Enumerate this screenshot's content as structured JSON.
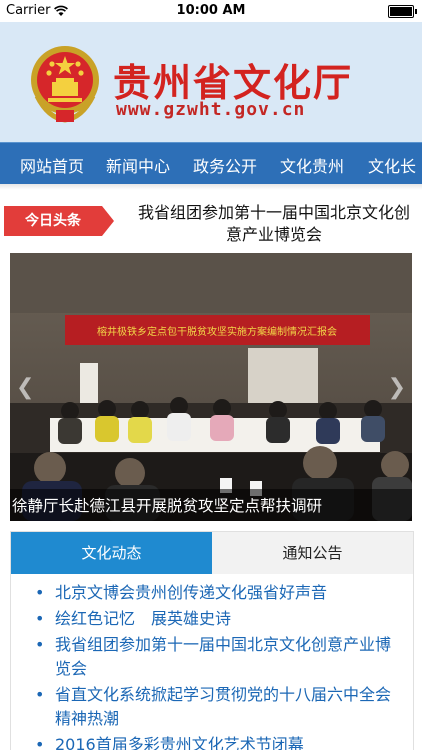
{
  "status_bar": {
    "carrier": "Carrier",
    "time": "10:00 AM"
  },
  "header": {
    "site_name": "贵州省文化厅",
    "site_url": "www.gzwht.gov.cn"
  },
  "nav": {
    "items": [
      "网站首页",
      "新闻中心",
      "政务公开",
      "文化贵州",
      "文化长"
    ]
  },
  "headline": {
    "badge": "今日头条",
    "text": "我省组团参加第十一届中国北京文化创意产业博览会"
  },
  "slider": {
    "banner_text": "榕井极铁乡定点包干脱贫攻坚实施方案编制情况汇报会",
    "caption": "徐静厅长赴德江县开展脱贫攻坚定点帮扶调研"
  },
  "tabs": {
    "active": "文化动态",
    "inactive": "通知公告"
  },
  "news": {
    "items": [
      "北京文博会贵州创传递文化强省好声音",
      "绘红色记忆　展英雄史诗",
      "我省组团参加第十一届中国北京文化创意产业博览会",
      "省直文化系统掀起学习贯彻党的十八届六中全会精神热潮",
      "2016首届多彩贵州文化艺术节闭幕"
    ]
  },
  "colors": {
    "brand_red": "#d3231f",
    "nav_blue": "#2d6fb7",
    "tab_blue": "#1f8ad0",
    "link_blue": "#1b67b5",
    "header_bg": "#d9e8f6"
  }
}
